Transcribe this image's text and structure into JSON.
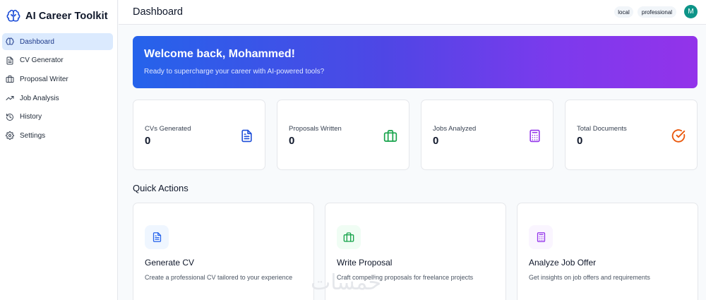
{
  "app": {
    "name": "AI Career Toolkit"
  },
  "sidebar": {
    "items": [
      {
        "label": "Dashboard",
        "icon": "brain-icon",
        "active": true
      },
      {
        "label": "CV Generator",
        "icon": "document-icon",
        "active": false
      },
      {
        "label": "Proposal Writer",
        "icon": "briefcase-icon",
        "active": false
      },
      {
        "label": "Job Analysis",
        "icon": "trending-up-icon",
        "active": false
      },
      {
        "label": "History",
        "icon": "history-icon",
        "active": false
      },
      {
        "label": "Settings",
        "icon": "gear-icon",
        "active": false
      }
    ]
  },
  "header": {
    "title": "Dashboard",
    "badges": [
      "local",
      "professional"
    ],
    "avatar_initial": "M"
  },
  "banner": {
    "title": "Welcome back, Mohammed!",
    "subtitle": "Ready to supercharge your career with AI-powered tools?"
  },
  "stats": [
    {
      "label": "CVs Generated",
      "value": "0",
      "icon": "document-icon",
      "color": "#1d4ed8"
    },
    {
      "label": "Proposals Written",
      "value": "0",
      "icon": "briefcase-icon",
      "color": "#16a34a"
    },
    {
      "label": "Jobs Analyzed",
      "value": "0",
      "icon": "calculator-icon",
      "color": "#9333ea"
    },
    {
      "label": "Total Documents",
      "value": "0",
      "icon": "check-circle-icon",
      "color": "#ea580c"
    }
  ],
  "quick_actions": {
    "title": "Quick Actions",
    "items": [
      {
        "title": "Generate CV",
        "description": "Create a professional CV tailored to your experience",
        "icon": "document-icon",
        "color": "#2563eb"
      },
      {
        "title": "Write Proposal",
        "description": "Craft compelling proposals for freelance projects",
        "icon": "briefcase-icon",
        "color": "#16a34a"
      },
      {
        "title": "Analyze Job Offer",
        "description": "Get insights on job offers and requirements",
        "icon": "calculator-icon",
        "color": "#9333ea"
      }
    ]
  },
  "watermark": {
    "text": "خمسات"
  },
  "colors": {
    "accent": "#2563eb",
    "nav_active_bg": "#dbeafe",
    "avatar_bg": "#0d9488",
    "banner_gradient": [
      "#2563eb",
      "#9333ea"
    ]
  }
}
